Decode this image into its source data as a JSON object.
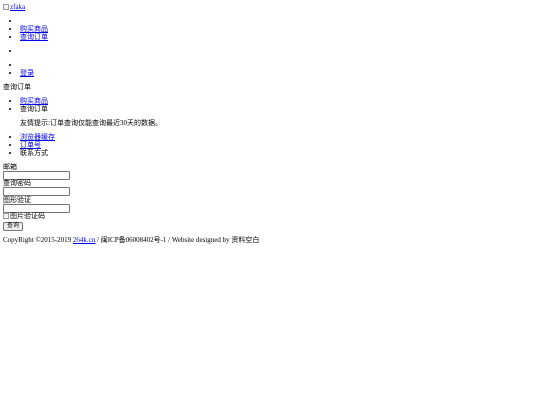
{
  "logo": {
    "alt": "zfaka"
  },
  "nav_top": [
    {
      "label": ""
    },
    {
      "label": "购买商品",
      "link": true
    },
    {
      "label": "查询订单",
      "link": true
    }
  ],
  "nav_mid": [
    {
      "label": ""
    }
  ],
  "nav_user": [
    {
      "label": ""
    },
    {
      "label": "登录",
      "link": true
    }
  ],
  "section_title": "查询订单",
  "breadcrumb": [
    {
      "label": "购买商品",
      "link": true
    },
    {
      "label": "查询订单",
      "link": false
    }
  ],
  "notice": "友情提示:订单查询仅能查询最近30天的数据。",
  "query_tabs": [
    {
      "label": "浏览器缓存",
      "link": true
    },
    {
      "label": "订单号",
      "link": true
    },
    {
      "label": "联系方式",
      "link": false
    }
  ],
  "form": {
    "email_label": "邮箱",
    "email_value": "",
    "password_label": "查询密码",
    "password_value": "",
    "captcha_label": "图形验证",
    "captcha_value": "",
    "captcha_image_alt": "图片验证码",
    "submit_label": "查询"
  },
  "footer": {
    "prefix": "CopyRight ©2015-2019 ",
    "link": "264k.cn",
    "suffix": " / 闽ICP备06008402号-1 / Website designed by 资料空白"
  }
}
